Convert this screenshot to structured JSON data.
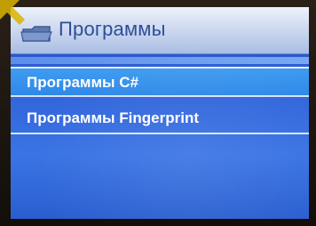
{
  "header": {
    "title": "Программы",
    "icon": "folder-icon"
  },
  "menu": {
    "items": [
      {
        "label": "Программы C#",
        "selected": true
      },
      {
        "label": "Программы Fingerprint",
        "selected": false
      }
    ]
  },
  "colors": {
    "screen_background": "#2f5fd8",
    "title_text": "#2d4f98",
    "selection": "#3a93ee",
    "menu_text": "#ffffff"
  }
}
